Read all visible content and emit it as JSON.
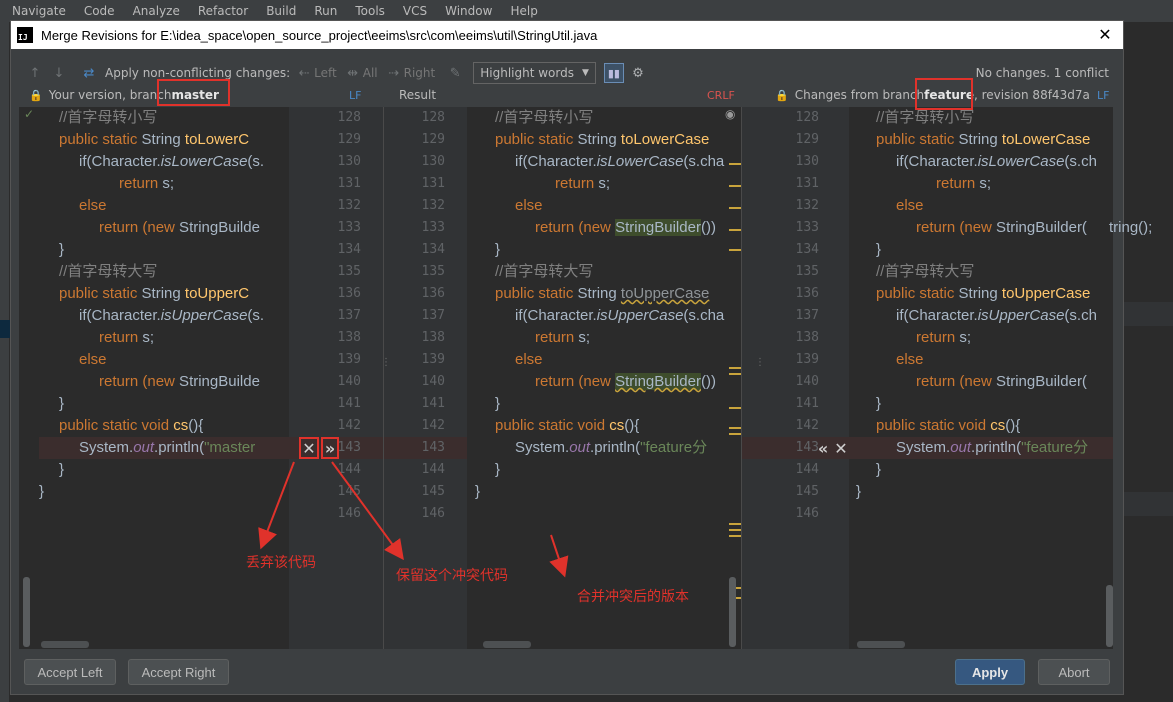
{
  "ide_menu": [
    "Navigate",
    "Code",
    "Analyze",
    "Refactor",
    "Build",
    "Run",
    "Tools",
    "VCS",
    "Window",
    "Help"
  ],
  "dialog": {
    "title": "Merge Revisions for E:\\idea_space\\open_source_project\\eeims\\src\\com\\eeims\\util\\StringUtil.java",
    "close_glyph": "✕"
  },
  "toolbar": {
    "apply_label": "Apply non-conflicting changes:",
    "left_label": "Left",
    "all_label": "All",
    "right_label": "Right",
    "highlight_combo": "Highlight words",
    "status": "No changes. 1 conflict"
  },
  "headers": {
    "left_prefix": "Your version, branch ",
    "left_branch": "master",
    "left_sep": "LF",
    "result_label": "Result",
    "result_sep": "CRLF",
    "right_prefix": "Changes from branch ",
    "right_branch": "feature",
    "right_suffix": ", revision 88f43d7a",
    "right_sep": "LF"
  },
  "line_numbers": [
    "128",
    "129",
    "130",
    "131",
    "132",
    "133",
    "134",
    "135",
    "136",
    "137",
    "138",
    "139",
    "140",
    "141",
    "142",
    "143",
    "144",
    "145",
    "146"
  ],
  "left_lines": [
    [
      "//首字母转小写"
    ],
    [
      "public static String toLowerC"
    ],
    [
      "if(Character.isLowerCase(s."
    ],
    [
      "return s;"
    ],
    [
      "else"
    ],
    [
      "return (new StringBuilde"
    ],
    [
      "}"
    ],
    [
      "//首字母转大写"
    ],
    [
      "public static String toUpperC"
    ],
    [
      "if(Character.isUpperCase(s."
    ],
    [
      "return s;"
    ],
    [
      "else"
    ],
    [
      "return (new StringBuilde"
    ],
    [
      "}"
    ],
    [
      "public static void cs(){"
    ],
    [
      "System.out.println(\"master"
    ],
    [
      "}"
    ],
    [
      "}"
    ]
  ],
  "code_tokens": {
    "comment_lower": "//首字母转小写",
    "comment_upper": "//首字母转大写",
    "public_static": "public static",
    "string_type": " String ",
    "to_lower": "toLowerC",
    "to_lower_result": "toLowerCase",
    "to_lower_right": "toLowerCase",
    "to_upper": "toUpperC",
    "to_upper_result": "toUpperCase",
    "to_upper_right": "toUpperCase",
    "if_open": "if(Character.",
    "is_lower": "isLowerCase",
    "is_upper": "isUpperCase",
    "left_cond_tail": "(s.",
    "result_cond_tail": "(s.cha",
    "right_cond_tail": "(s.ch",
    "return_s": "return s;",
    "return_kw": "return",
    "s_semicolon": " s;",
    "else_kw": "else",
    "return_paren": "return (",
    "new_kw": "new",
    "sb_left": " StringBuilde",
    "sb_result": "StringBuilder",
    "sb_result_tail": "())",
    "sb_right": " StringBuilder(",
    "right_overflow": "tring();",
    "brace": "}",
    "void_sig": " void ",
    "cs_name": "cs",
    "cs_tail": "(){",
    "sysout_pre": "System.",
    "out_kw": "out",
    "println": ".println(",
    "master_str": "\"master",
    "feature_str_result": "\"feature分",
    "feature_str_right": "\"feature分"
  },
  "conflict_actions": {
    "left_discard": "✕",
    "left_accept": "»",
    "right_accept": "«",
    "right_discard": "✕"
  },
  "annotations": {
    "discard": "丢弃该代码",
    "keep": "保留这个冲突代码",
    "merged": "合并冲突后的版本"
  },
  "buttons": {
    "accept_left": "Accept Left",
    "accept_right": "Accept Right",
    "apply": "Apply",
    "abort": "Abort"
  }
}
